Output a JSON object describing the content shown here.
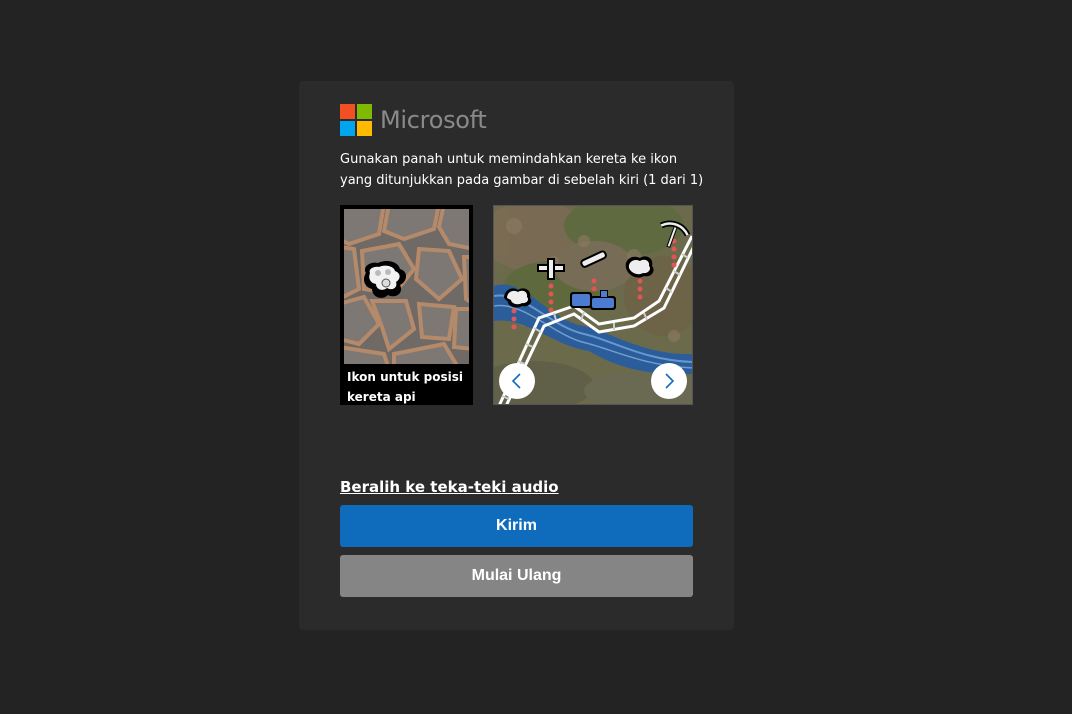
{
  "logo": {
    "text": "Microsoft",
    "colors": [
      "#f25022",
      "#7fba00",
      "#00a4ef",
      "#ffb900"
    ]
  },
  "instructions": "Gunakan panah untuk memindahkan kereta ke ikon yang ditunjukkan pada gambar di sebelah kiri (1 dari 1)",
  "reference": {
    "caption": "Ikon untuk posisi kereta api"
  },
  "scene": {
    "prev_icon": "chevron-left-icon",
    "next_icon": "chevron-right-icon"
  },
  "audio_link": "Beralih ke teka-teki audio",
  "buttons": {
    "submit": "Kirim",
    "restart": "Mulai Ulang"
  },
  "theme": {
    "background": "#232323",
    "card": "#2b2b2b",
    "primary": "#0f6cbd",
    "secondary": "#858585"
  }
}
